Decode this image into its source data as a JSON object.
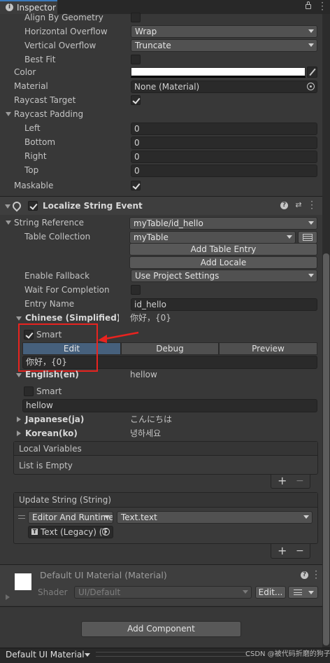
{
  "tab": {
    "title": "Inspector"
  },
  "text_settings": {
    "align_by_geometry": "Align By Geometry",
    "horizontal_overflow": {
      "label": "Horizontal Overflow",
      "value": "Wrap"
    },
    "vertical_overflow": {
      "label": "Vertical Overflow",
      "value": "Truncate"
    },
    "best_fit": "Best Fit",
    "color": "Color",
    "material": {
      "label": "Material",
      "value": "None (Material)"
    },
    "raycast_target": "Raycast Target",
    "raycast_padding": "Raycast Padding",
    "padding": [
      {
        "label": "Left",
        "value": "0"
      },
      {
        "label": "Bottom",
        "value": "0"
      },
      {
        "label": "Right",
        "value": "0"
      },
      {
        "label": "Top",
        "value": "0"
      }
    ],
    "maskable": "Maskable"
  },
  "localize": {
    "title": "Localize String Event",
    "string_reference": {
      "label": "String Reference",
      "value": "myTable/id_hello"
    },
    "table_collection": {
      "label": "Table Collection",
      "value": "myTable"
    },
    "add_table_entry": "Add Table Entry",
    "add_locale": "Add Locale",
    "enable_fallback": {
      "label": "Enable Fallback",
      "value": "Use Project Settings"
    },
    "wait_for_completion": "Wait For Completion",
    "entry_name": {
      "label": "Entry Name",
      "value": "id_hello"
    },
    "chinese": {
      "label": "Chinese (Simplified)(zl",
      "value": "你好，{0}",
      "smart": "Smart",
      "text": "你好，{0}"
    },
    "tabs": [
      "Edit",
      "Debug",
      "Preview"
    ],
    "english": {
      "label": "English(en)",
      "value": "hellow",
      "smart": "Smart",
      "text": "hellow"
    },
    "japanese": {
      "label": "Japanese(ja)",
      "value": "こんにちは"
    },
    "korean": {
      "label": "Korean(ko)",
      "value": "녕하세요"
    },
    "local_variables": {
      "title": "Local Variables",
      "empty": "List is Empty"
    },
    "update_string": {
      "title": "Update String (String)",
      "mode": "Editor And Runtime",
      "function": "Text.text",
      "object": "Text (Legacy) (T"
    }
  },
  "material": {
    "name": "Default UI Material (Material)",
    "shader_label": "Shader",
    "shader_value": "UI/Default",
    "edit": "Edit..."
  },
  "add_component": "Add Component",
  "bottom_bar": {
    "label": "Default UI Material",
    "watermark": "CSDN @被代码折磨的狗子"
  },
  "glyphs": {
    "plus": "+",
    "minus": "−"
  }
}
